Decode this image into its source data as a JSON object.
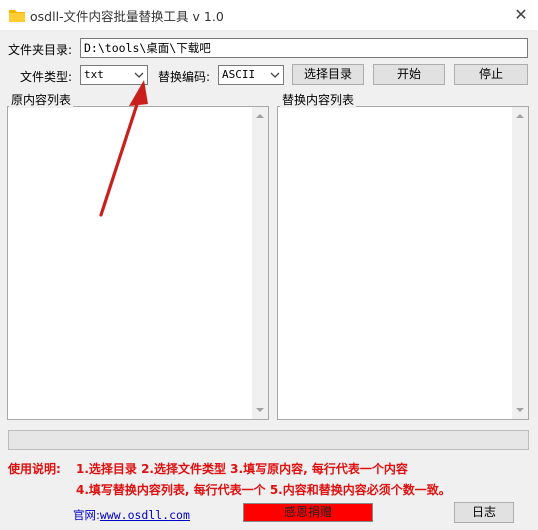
{
  "window": {
    "title": "osdll-文件内容批量替换工具 v 1.0",
    "close_glyph": "✕"
  },
  "folder": {
    "label": "文件夹目录:",
    "value": "D:\\tools\\桌面\\下载吧"
  },
  "filetype": {
    "label": "文件类型:",
    "value": "txt"
  },
  "encoding": {
    "label": "替换编码:",
    "value": "ASCII"
  },
  "buttons": {
    "select_dir": "选择目录",
    "start": "开始",
    "stop": "停止",
    "donate": "感恩捐赠",
    "log": "日志"
  },
  "lists": {
    "original_title": "原内容列表",
    "replace_title": "替换内容列表"
  },
  "instructions": {
    "heading": "使用说明:",
    "line1": "1.选择目录   2.选择文件类型   3.填写原内容, 每行代表一个内容",
    "line2": "4.填写替换内容列表, 每行代表一个   5.内容和替换内容必须个数一致。"
  },
  "website": {
    "label": "官网:",
    "url": "www.osdll.com"
  },
  "colors": {
    "annotation_arrow": "#c8201c",
    "instruction_text": "#e01010",
    "donate_bg": "#ff0000",
    "link": "#0000c8"
  }
}
